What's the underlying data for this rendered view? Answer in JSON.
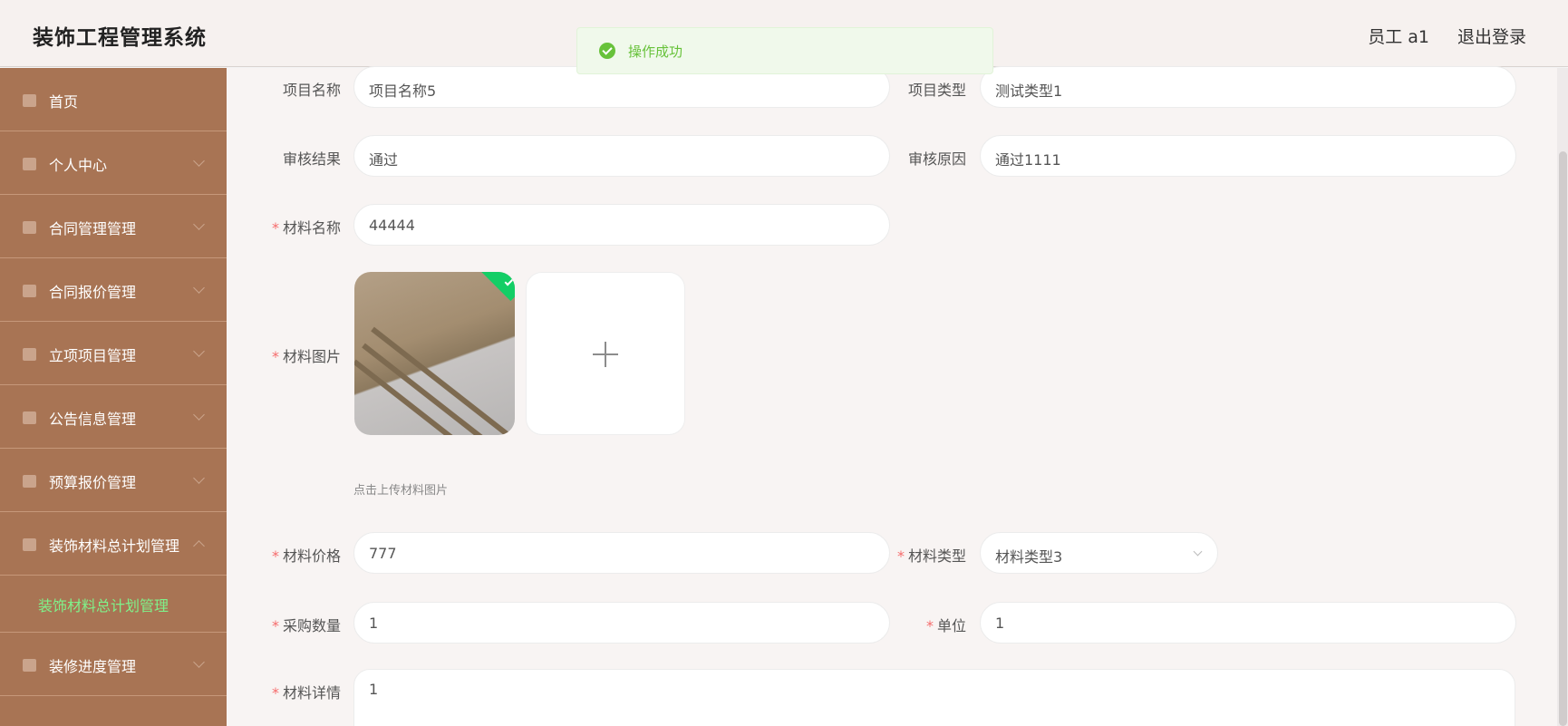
{
  "header": {
    "title": "装饰工程管理系统",
    "user": "员工 a1",
    "logout": "退出登录"
  },
  "toast": {
    "message": "操作成功",
    "icon": "success-circle-icon"
  },
  "sidebar": {
    "items": [
      {
        "label": "首页",
        "icon": "home-icon"
      },
      {
        "label": "个人中心",
        "icon": "user-icon"
      },
      {
        "label": "合同管理管理",
        "icon": "contract-icon"
      },
      {
        "label": "合同报价管理",
        "icon": "list-icon"
      },
      {
        "label": "立项项目管理",
        "icon": "project-icon"
      },
      {
        "label": "公告信息管理",
        "icon": "notice-icon"
      },
      {
        "label": "预算报价管理",
        "icon": "budget-icon"
      },
      {
        "label": "装饰材料总计划管理",
        "icon": "material-icon"
      },
      {
        "label": "装修进度管理",
        "icon": "progress-icon"
      }
    ],
    "active_sub_item": "装饰材料总计划管理"
  },
  "form": {
    "project_name": {
      "label": "项目名称",
      "value": "项目名称5"
    },
    "project_type": {
      "label": "项目类型",
      "value": "测试类型1"
    },
    "review_result": {
      "label": "审核结果",
      "value": "通过"
    },
    "review_reason": {
      "label": "审核原因",
      "value": "通过1111"
    },
    "material_name": {
      "label": "材料名称",
      "value": "44444"
    },
    "material_image": {
      "label": "材料图片",
      "tip": "点击上传材料图片"
    },
    "material_price": {
      "label": "材料价格",
      "value": "777"
    },
    "material_type": {
      "label": "材料类型",
      "value": "材料类型3"
    },
    "purchase_qty": {
      "label": "采购数量",
      "value": "1"
    },
    "unit": {
      "label": "单位",
      "value": "1"
    },
    "material_detail": {
      "label": "材料详情",
      "value": "1"
    }
  },
  "colors": {
    "sidebar_bg": "#a87454",
    "active_submenu": "#7ff28a",
    "success": "#67c23a",
    "required": "#f56c6c"
  }
}
